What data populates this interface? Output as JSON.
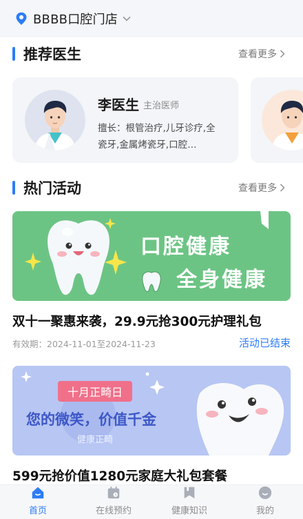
{
  "header": {
    "store_name": "BBBB口腔门店"
  },
  "doctors_section": {
    "title": "推荐医生",
    "more_label": "查看更多",
    "doctors": [
      {
        "name": "李医生",
        "title": "主治医师",
        "specialty": "擅长：根管治疗,儿牙诊疗,全瓷牙,金属烤瓷牙,口腔…"
      }
    ]
  },
  "activities_section": {
    "title": "热门活动",
    "more_label": "查看更多",
    "activities": [
      {
        "banner_line1": "口腔健康",
        "banner_line2": "全身健康",
        "title": "双十一聚惠来袭，29.9元抢300元护理礼包",
        "validity": "有效期：2024-11-01至2024-11-23",
        "status": "活动已结束"
      },
      {
        "banner_tag": "十月正畸日",
        "banner_main": "您的微笑，价值千金",
        "banner_sub": "健康正畸",
        "title": "599元抢价值1280元家庭大礼包套餐"
      }
    ]
  },
  "tabbar": {
    "active": "首页",
    "items": [
      {
        "label": "首页",
        "icon": "home-icon"
      },
      {
        "label": "在线预约",
        "icon": "calendar-icon"
      },
      {
        "label": "健康知识",
        "icon": "bookmark-icon"
      },
      {
        "label": "我的",
        "icon": "profile-icon"
      }
    ]
  },
  "colors": {
    "accent": "#2d7cf6",
    "banner_green": "#6cc484",
    "banner_blue": "#b7c6f3"
  }
}
